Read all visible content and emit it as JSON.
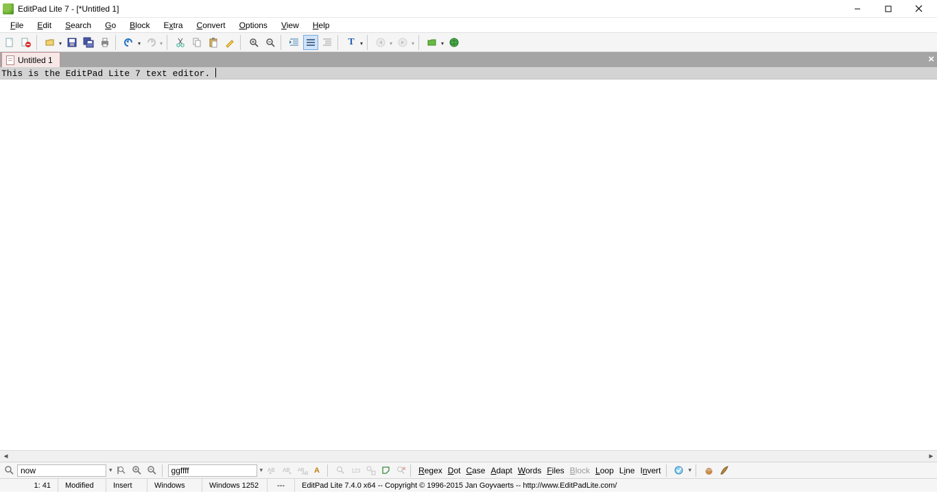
{
  "title": "EditPad Lite 7 - [*Untitled 1]",
  "menus": {
    "file": "File",
    "edit": "Edit",
    "search": "Search",
    "go": "Go",
    "block": "Block",
    "extra": "Extra",
    "convert": "Convert",
    "options": "Options",
    "view": "View",
    "help": "Help"
  },
  "tab": {
    "label": "Untitled 1"
  },
  "editor": {
    "line": "This is the EditPad Lite 7 text editor. "
  },
  "search": {
    "find_value": "now",
    "replace_value": "ggffff",
    "regex": "Regex",
    "dot": "Dot",
    "case": "Case",
    "adapt": "Adapt",
    "words": "Words",
    "files": "Files",
    "block": "Block",
    "loop": "Loop",
    "line": "Line",
    "invert": "Invert"
  },
  "status": {
    "pos": "1: 41",
    "modified": "Modified",
    "insert": "Insert",
    "lineend": "Windows",
    "encoding": "Windows 1252",
    "dashes": "---",
    "copyright": "EditPad Lite 7.4.0 x64  --  Copyright © 1996-2015  Jan Goyvaerts  --  http://www.EditPadLite.com/"
  }
}
